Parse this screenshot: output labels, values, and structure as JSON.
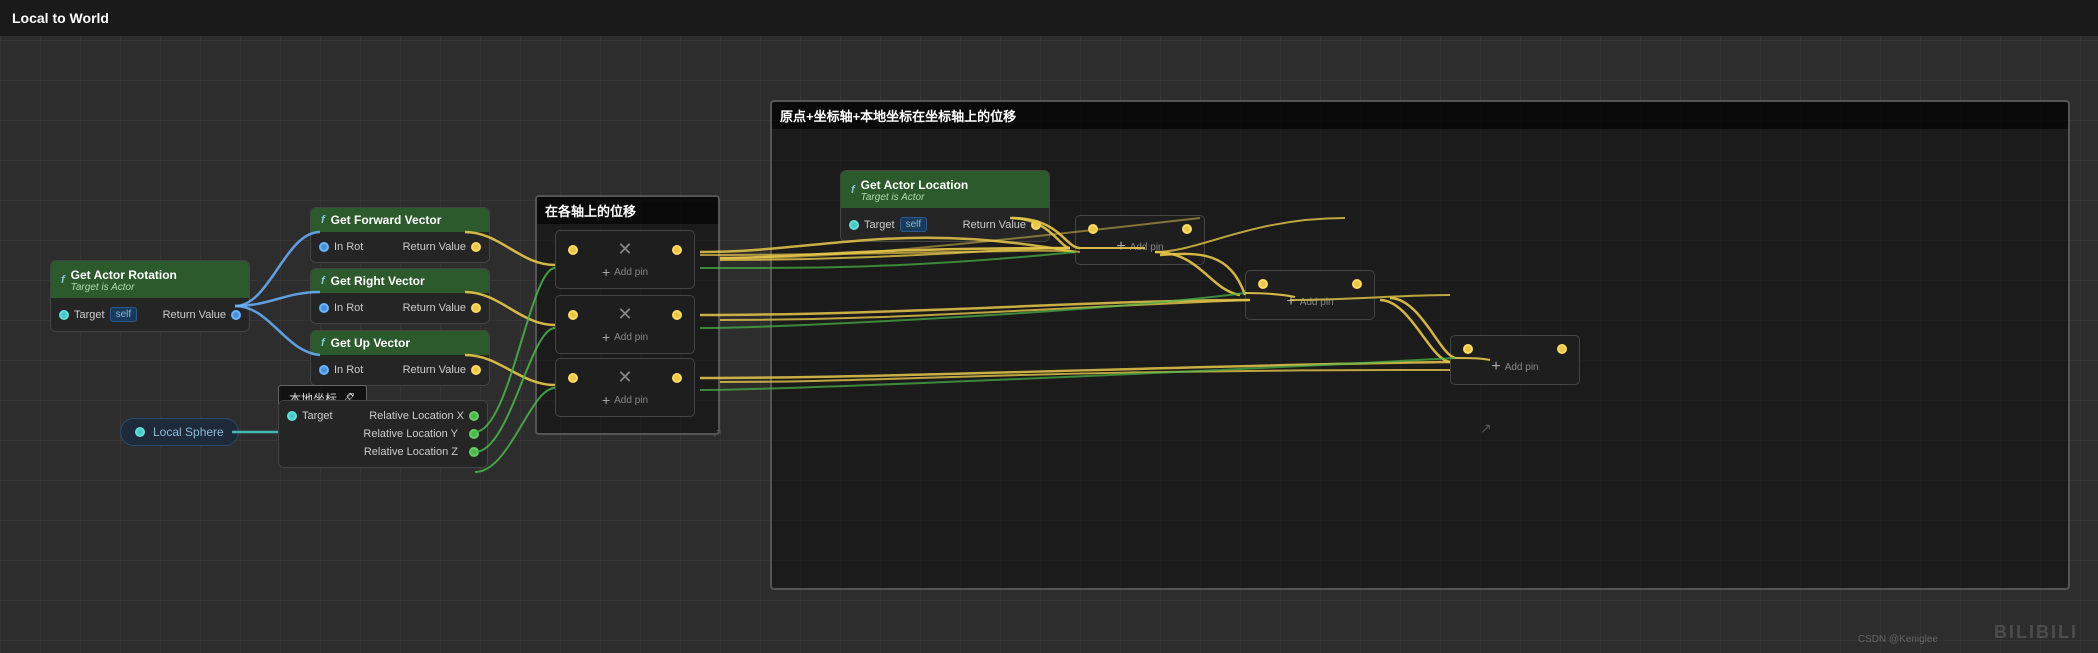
{
  "title": "Local to World",
  "nodes": {
    "get_actor_rotation": {
      "title": "Get Actor Rotation",
      "subtitle": "Target is Actor",
      "target_label": "Target",
      "target_value": "self",
      "return_label": "Return Value",
      "func_icon": "f"
    },
    "get_forward_vector": {
      "title": "Get Forward Vector",
      "in_rot_label": "In Rot",
      "return_label": "Return Value",
      "func_icon": "f"
    },
    "get_right_vector": {
      "title": "Get Right Vector",
      "in_rot_label": "In Rot",
      "return_label": "Return Value",
      "func_icon": "f"
    },
    "get_up_vector": {
      "title": "Get Up Vector",
      "in_rot_label": "In Rot",
      "return_label": "Return Value",
      "func_icon": "f"
    },
    "local_sphere": {
      "title": "Local Sphere"
    },
    "get_component_location": {
      "target_label": "Target",
      "relative_x": "Relative Location X",
      "relative_y": "Relative Location Y",
      "relative_z": "Relative Location Z"
    },
    "get_actor_location": {
      "title": "Get Actor Location",
      "subtitle": "Target is Actor",
      "target_label": "Target",
      "target_value": "self",
      "return_label": "Return Value",
      "func_icon": "f"
    },
    "comment_each_axis": {
      "label": "在各轴上的位移"
    },
    "comment_local_coord": {
      "label": "本地坐标 🖊"
    },
    "comment_main": {
      "label": "原点+坐标轴+本地坐标在坐标轴上的位移"
    }
  },
  "add_pin_boxes": {
    "box1": {
      "label": "Add pin",
      "plus": "+"
    },
    "box2": {
      "label": "Add pin",
      "plus": "+"
    },
    "box3": {
      "label": "Add pin",
      "plus": "+"
    },
    "box4": {
      "label": "Add pin",
      "plus": "+"
    },
    "box5": {
      "label": "Add pin",
      "plus": "+"
    },
    "box6": {
      "label": "Add pin",
      "plus": "+"
    }
  },
  "watermark": "BILIBILI",
  "credit": "CSDN @Keniglee"
}
